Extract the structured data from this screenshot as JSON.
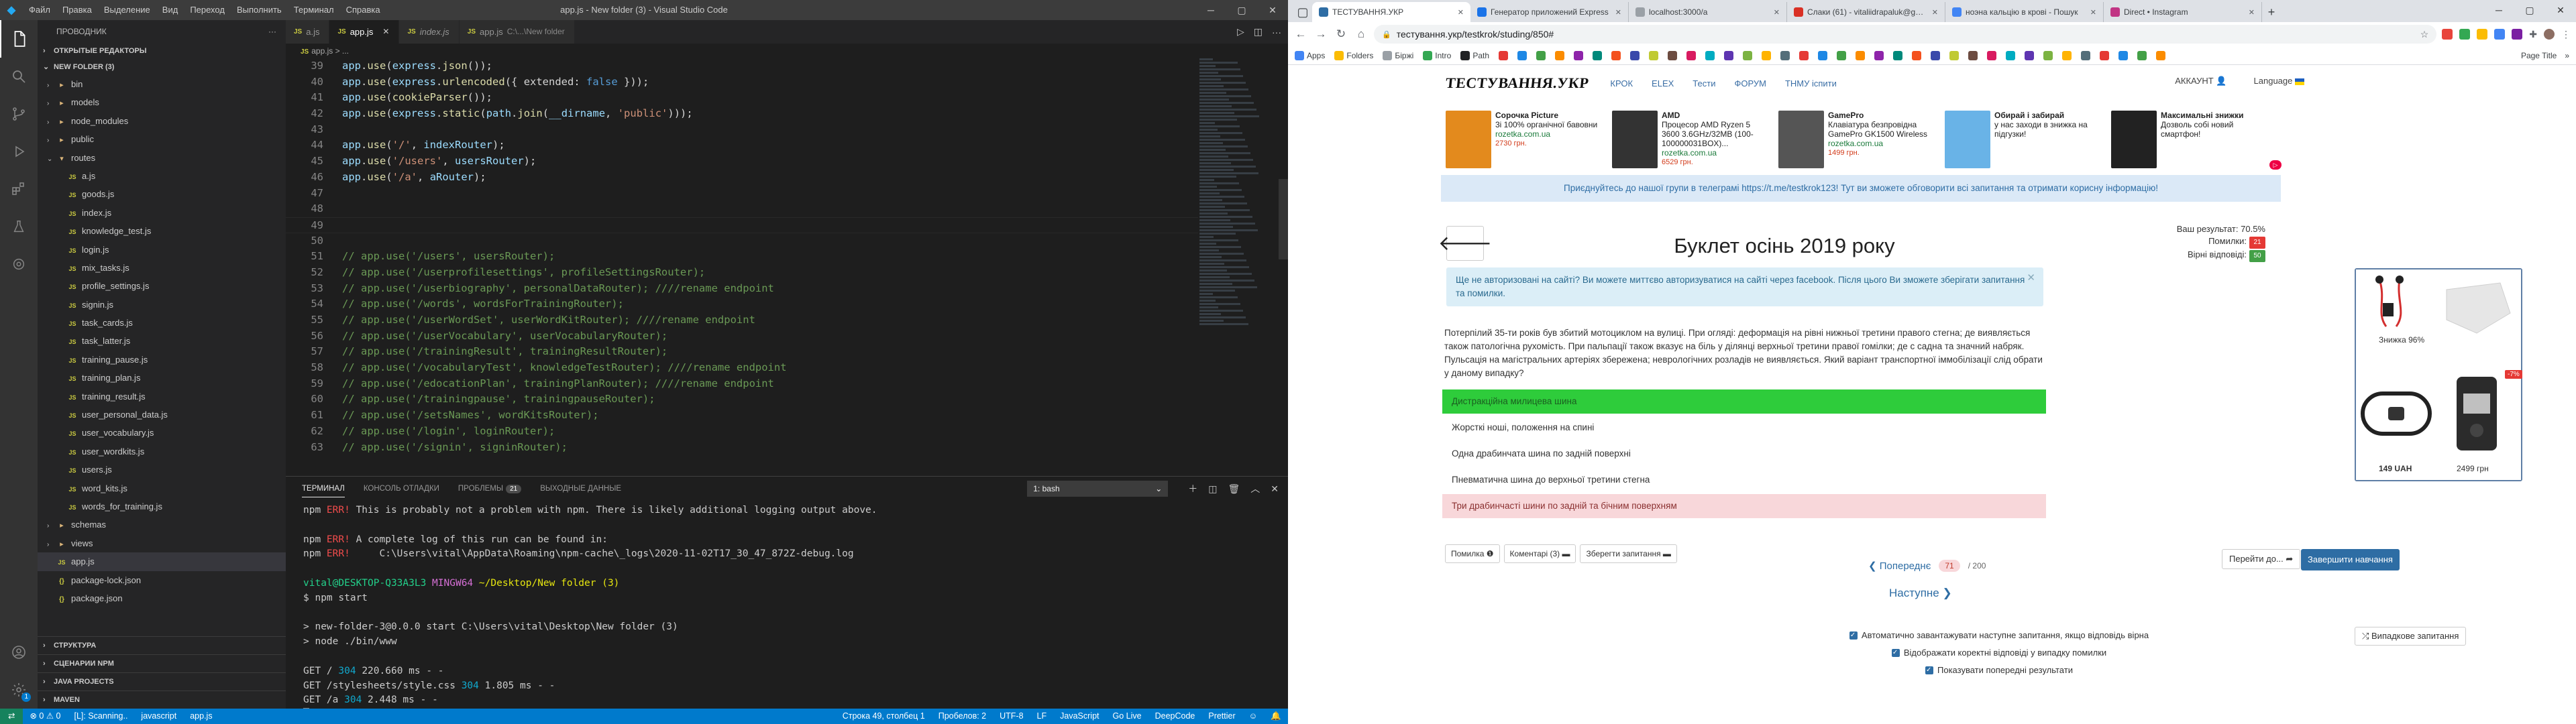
{
  "vscode": {
    "title": "app.js - New folder (3) - Visual Studio Code",
    "menu": [
      "Файл",
      "Правка",
      "Выделение",
      "Вид",
      "Переход",
      "Выполнить",
      "Терминал",
      "Справка"
    ],
    "explorer_header": "ПРОВОДНИК",
    "open_editors": "ОТКРЫТЫЕ РЕДАКТОРЫ",
    "folder": "NEW FOLDER (3)",
    "tree": [
      {
        "name": "bin",
        "type": "folder",
        "depth": 1
      },
      {
        "name": "models",
        "type": "folder",
        "depth": 1
      },
      {
        "name": "node_modules",
        "type": "folder",
        "depth": 1
      },
      {
        "name": "public",
        "type": "folder",
        "depth": 1
      },
      {
        "name": "routes",
        "type": "folder-open",
        "depth": 1
      },
      {
        "name": "a.js",
        "type": "js",
        "depth": 2
      },
      {
        "name": "goods.js",
        "type": "js",
        "depth": 2
      },
      {
        "name": "index.js",
        "type": "js",
        "depth": 2
      },
      {
        "name": "knowledge_test.js",
        "type": "js",
        "depth": 2
      },
      {
        "name": "login.js",
        "type": "js",
        "depth": 2
      },
      {
        "name": "mix_tasks.js",
        "type": "js",
        "depth": 2
      },
      {
        "name": "profile_settings.js",
        "type": "js",
        "depth": 2
      },
      {
        "name": "signin.js",
        "type": "js",
        "depth": 2
      },
      {
        "name": "task_cards.js",
        "type": "js",
        "depth": 2
      },
      {
        "name": "task_latter.js",
        "type": "js",
        "depth": 2
      },
      {
        "name": "training_pause.js",
        "type": "js",
        "depth": 2
      },
      {
        "name": "training_plan.js",
        "type": "js",
        "depth": 2
      },
      {
        "name": "training_result.js",
        "type": "js",
        "depth": 2
      },
      {
        "name": "user_personal_data.js",
        "type": "js",
        "depth": 2
      },
      {
        "name": "user_vocabulary.js",
        "type": "js",
        "depth": 2
      },
      {
        "name": "user_wordkits.js",
        "type": "js",
        "depth": 2
      },
      {
        "name": "users.js",
        "type": "js",
        "depth": 2
      },
      {
        "name": "word_kits.js",
        "type": "js",
        "depth": 2
      },
      {
        "name": "words_for_training.js",
        "type": "js",
        "depth": 2
      },
      {
        "name": "schemas",
        "type": "folder",
        "depth": 1
      },
      {
        "name": "views",
        "type": "folder",
        "depth": 1
      },
      {
        "name": "app.js",
        "type": "js",
        "depth": 1,
        "active": true
      },
      {
        "name": "package-lock.json",
        "type": "json",
        "depth": 1
      },
      {
        "name": "package.json",
        "type": "json",
        "depth": 1
      }
    ],
    "bottom_sections": [
      "СТРУКТУРА",
      "СЦЕНАРИИ NPM",
      "JAVA PROJECTS",
      "MAVEN"
    ],
    "tabs": [
      {
        "label": "a.js",
        "desc": "",
        "active": false,
        "italic": false
      },
      {
        "label": "app.js",
        "desc": "",
        "active": true,
        "italic": false
      },
      {
        "label": "index.js",
        "desc": "",
        "active": false,
        "italic": true
      },
      {
        "label": "app.js",
        "desc": "C:\\...\\New folder",
        "active": false,
        "italic": false
      }
    ],
    "breadcrumb": "app.js > ...",
    "code": [
      {
        "n": "39",
        "t": "app.use(express.json());",
        "kind": "use"
      },
      {
        "n": "40",
        "t": "app.use(express.urlencoded({ extended: false }));",
        "kind": "use"
      },
      {
        "n": "41",
        "t": "app.use(cookieParser());",
        "kind": "use"
      },
      {
        "n": "42",
        "t": "app.use(express.static(path.join(__dirname, 'public')));",
        "kind": "use"
      },
      {
        "n": "43",
        "t": "",
        "kind": "empty"
      },
      {
        "n": "44",
        "t": "app.use('/', indexRouter);",
        "kind": "use"
      },
      {
        "n": "45",
        "t": "app.use('/users', usersRouter);",
        "kind": "use"
      },
      {
        "n": "46",
        "t": "app.use('/a', aRouter);",
        "kind": "use"
      },
      {
        "n": "47",
        "t": "",
        "kind": "empty"
      },
      {
        "n": "48",
        "t": "",
        "kind": "empty"
      },
      {
        "n": "49",
        "t": "",
        "kind": "current"
      },
      {
        "n": "50",
        "t": "",
        "kind": "empty"
      },
      {
        "n": "51",
        "t": "// app.use('/users', usersRouter);",
        "kind": "comment"
      },
      {
        "n": "52",
        "t": "// app.use('/userprofilesettings', profileSettingsRouter);",
        "kind": "comment"
      },
      {
        "n": "53",
        "t": "// app.use('/userbiography', personalDataRouter); ////rename endpoint",
        "kind": "comment"
      },
      {
        "n": "54",
        "t": "// app.use('/words', wordsForTrainingRouter);",
        "kind": "comment"
      },
      {
        "n": "55",
        "t": "// app.use('/userWordSet', userWordKitRouter); ////rename endpoint",
        "kind": "comment"
      },
      {
        "n": "56",
        "t": "// app.use('/userVocabulary', userVocabularyRouter);",
        "kind": "comment"
      },
      {
        "n": "57",
        "t": "// app.use('/trainingResult', trainingResultRouter);",
        "kind": "comment"
      },
      {
        "n": "58",
        "t": "// app.use('/vocabularyTest', knowledgeTestRouter); ////rename endpoint",
        "kind": "comment"
      },
      {
        "n": "59",
        "t": "// app.use('/edocationPlan', trainingPlanRouter); ////rename endpoint",
        "kind": "comment"
      },
      {
        "n": "60",
        "t": "// app.use('/trainingpause', trainingpauseRouter);",
        "kind": "comment"
      },
      {
        "n": "61",
        "t": "// app.use('/setsNames', wordKitsRouter);",
        "kind": "comment"
      },
      {
        "n": "62",
        "t": "// app.use('/login', loginRouter);",
        "kind": "comment"
      },
      {
        "n": "63",
        "t": "// app.use('/signin', signinRouter);",
        "kind": "comment"
      }
    ],
    "panel_tabs": {
      "terminal": "ТЕРМИНАЛ",
      "output": "КОНСОЛЬ ОТЛАДКИ",
      "problems": "ПРОБЛЕМЫ",
      "problems_count": "21",
      "debug": "ВЫХОДНЫЕ ДАННЫЕ"
    },
    "terminal_select": "1: bash",
    "terminal": [
      {
        "pre": "npm ",
        "tag": "ERR!",
        "rest": " This is probably not a problem with npm. There is likely additional logging output above."
      },
      {
        "pre": "",
        "tag": "",
        "rest": ""
      },
      {
        "pre": "npm ",
        "tag": "ERR!",
        "rest": " A complete log of this run can be found in:"
      },
      {
        "pre": "npm ",
        "tag": "ERR!",
        "rest": "     C:\\Users\\vital\\AppData\\Roaming\\npm-cache\\_logs\\2020-11-02T17_30_47_872Z-debug.log"
      },
      {
        "pre": "",
        "tag": "",
        "rest": ""
      },
      {
        "prompt_user": "vital@DESKTOP-Q33A3L3",
        "prompt_env": " MINGW64",
        "prompt_path": " ~/Desktop/New folder (3)"
      },
      {
        "pre": "$ npm start",
        "tag": "",
        "rest": ""
      },
      {
        "pre": "",
        "tag": "",
        "rest": ""
      },
      {
        "pre": "> new-folder-3@0.0.0 start C:\\Users\\vital\\Desktop\\New folder (3)",
        "tag": "",
        "rest": ""
      },
      {
        "pre": "> node ./bin/www",
        "tag": "",
        "rest": ""
      },
      {
        "pre": "",
        "tag": "",
        "rest": ""
      },
      {
        "req": "GET / ",
        "code": "304",
        "tail": " 220.660 ms - -"
      },
      {
        "req": "GET /stylesheets/style.css ",
        "code": "304",
        "tail": " 1.805 ms - -"
      },
      {
        "req": "GET /a ",
        "code": "304",
        "tail": " 2.448 ms - -"
      }
    ],
    "status_left": [
      "⊗ 0 ⚠ 0",
      "[L]: Scanning..",
      "javascript",
      "app.js"
    ],
    "status_right": [
      "Строка 49, столбец 1",
      "Пробелов: 2",
      "UTF-8",
      "LF",
      "JavaScript",
      "Go Live",
      "DeepCode",
      "Prettier"
    ]
  },
  "chrome": {
    "tabs": [
      {
        "title": "Генератор приложений Express",
        "color": "#1a73e8"
      },
      {
        "title": "localhost:3000/a",
        "color": "#9aa0a6"
      },
      {
        "title": "Слаки (61) - vitaliidrapaluk@gm...",
        "color": "#d93025"
      },
      {
        "title": "ноэна кальцію в крові - Пошук",
        "color": "#4285f4"
      },
      {
        "title": "Direct • Instagram",
        "color": "#c13584"
      }
    ],
    "url": "тестування.укр/testkrok/studing/850#",
    "bookmarks": [
      "Apps",
      "Folders",
      "Біржі",
      "Intro",
      "Path",
      "Page Title"
    ],
    "site": {
      "logo": "ТЕСТУВАННЯ.УКР",
      "nav": [
        "КРОК",
        "ELEX",
        "Тести",
        "ФОРУМ",
        "ТНМУ іспити"
      ],
      "account": "АККАУНТ",
      "language": "Language",
      "ads": [
        {
          "title": "Сорочка Picture",
          "text": "3i 100% органічної бавовни",
          "shop": "rozetka.com.ua",
          "price": "2730 грн.",
          "color": "#e38a1d"
        },
        {
          "title": "AMD",
          "text": "Процесор AMD Ryzen 5 3600 3.6GHz/32MB (100-100000031BOX)...",
          "shop": "rozetka.com.ua",
          "price": "6529 грн.",
          "color": "#333333"
        },
        {
          "title": "GamePro",
          "text": "Клавіатура безпровідна GamePro GK1500 Wireless",
          "shop": "rozetka.com.ua",
          "price": "1499 грн.",
          "color": "#555555"
        },
        {
          "title": "Обирай і забирай",
          "text": "у нас заходи в знижка на підгузки!",
          "shop": "",
          "price": "",
          "color": "#69b3e7"
        },
        {
          "title": "Максимальні знижки",
          "text": "Дозволь собі новий смартфон!",
          "shop": "",
          "price": "",
          "color": "#222222"
        }
      ],
      "telegram": "Приєднуйтесь до нашої групи в телеграмі https://t.me/testkrok123! Тут ви зможете обговорити всі запитання та отримати корисну інформацію!",
      "result_label": "Ваш результат:",
      "result_value": "70.5%",
      "errors_label": "Помилки:",
      "errors_value": "21",
      "correct_label": "Вірні відповіді:",
      "correct_value": "50",
      "title": "Буклет осінь 2019 року",
      "login_note": "Ще не авторизовані на сайті? Ви можете миттєво авторизуватися на сайті через facebook. Після цього Ви зможете зберігати запитання та помилки.",
      "question": "Потерпілий 35-ти років був збитий мотоциклом на вулиці. При огляді: деформація на рівні нижньої третини правого стегна; де виявляється також патологічна рухомість. При пальпації також вказує на біль у ділянці верхньої третини правої гомілки; де с садна та значний набряк. Пульсація на магістральних артеріях збережена; неврологічних розладів не виявляється. Який варіант транспортної іммобілізації слід обрати у даному випадку?",
      "answers": [
        {
          "text": "Дистракційна милицева шина",
          "state": "correct"
        },
        {
          "text": "Жорсткі ноші, положення на спині",
          "state": ""
        },
        {
          "text": "Одна драбинчата шина по задній поверхні",
          "state": ""
        },
        {
          "text": "Пневматична шина до верхньої третини стегна",
          "state": ""
        },
        {
          "text": "Три драбинчасті шини по задній та бічним поверхням",
          "state": "wrong"
        }
      ],
      "tools": [
        "Помилка ❶",
        "Коментарі (3) ▬",
        "Зберегти запитання ▬"
      ],
      "prev": "❮ Попереднє",
      "page_num": "71",
      "page_total": "/ 200",
      "next": "Наступне ❯",
      "goto": "Перейти до... ➦",
      "finish": "Завершити навчання",
      "checks": [
        "Автоматично завантажувати наступне запитання, якщо відповідь вірна",
        "Відображати коректні відповіді у випадку помилки",
        "Показувати попередні результати"
      ],
      "random": "⤮ Випадкове запитання",
      "products": [
        {
          "label": "Знижка 96%",
          "price": ""
        },
        {
          "label": "",
          "price": ""
        },
        {
          "label": "",
          "price": "149 UAH"
        },
        {
          "label": "",
          "price": "2499 грн"
        }
      ]
    }
  }
}
